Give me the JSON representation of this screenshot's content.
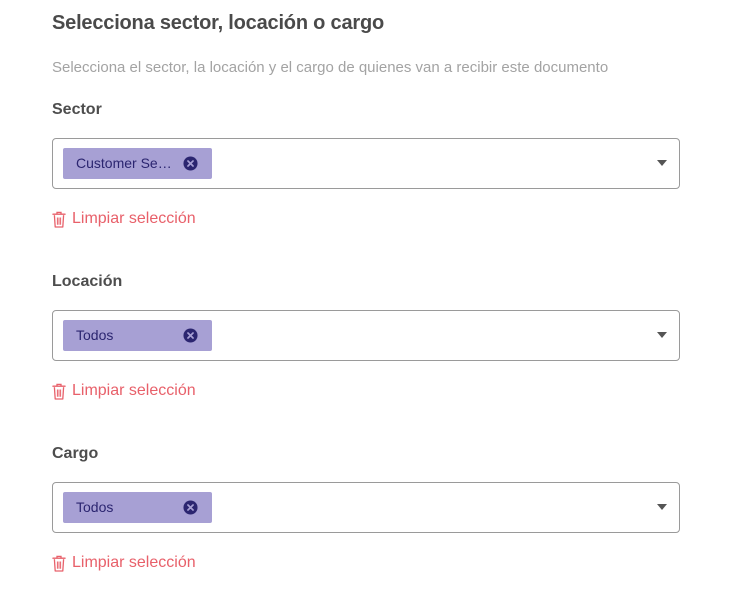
{
  "header": {
    "title": "Selecciona sector, locación o cargo",
    "subtitle": "Selecciona el sector, la locación y el cargo de quienes van a recibir este documento"
  },
  "sections": [
    {
      "label": "Sector",
      "chip": "Customer Service",
      "clear_label": "Limpiar selección"
    },
    {
      "label": "Locación",
      "chip": "Todos",
      "clear_label": "Limpiar selección"
    },
    {
      "label": "Cargo",
      "chip": "Todos",
      "clear_label": "Limpiar selección"
    }
  ],
  "colors": {
    "chip_bg": "#a7a0d4",
    "chip_text": "#2b2570",
    "danger": "#e8606a",
    "border": "#9a9a9a"
  },
  "icons": [
    "close-circle-icon",
    "caret-down-icon",
    "trash-icon"
  ]
}
